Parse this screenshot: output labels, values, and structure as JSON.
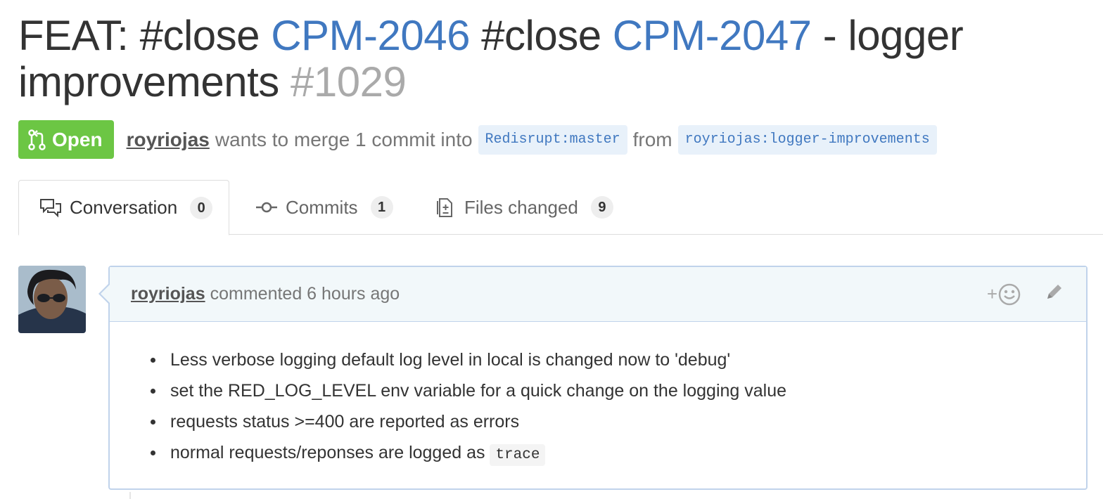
{
  "pr": {
    "title_prefix": "FEAT: #close",
    "issue1": "CPM-2046",
    "title_mid": "#close",
    "issue2": "CPM-2047",
    "title_suffix": "- logger improvements",
    "number": "#1029"
  },
  "state": {
    "label": "Open",
    "color": "#6cc644",
    "icon": "git-pull-request-icon"
  },
  "meta": {
    "author": "royriojas",
    "text_merge": "wants to merge 1 commit into",
    "base_owner": "Redisrupt",
    "base_branch": "master",
    "text_from": "from",
    "head_owner": "royriojas",
    "head_branch": "logger-improvements"
  },
  "tabs": [
    {
      "label": "Conversation",
      "count": "0",
      "icon": "comment-discussion-icon",
      "selected": true
    },
    {
      "label": "Commits",
      "count": "1",
      "icon": "git-commit-icon",
      "selected": false
    },
    {
      "label": "Files changed",
      "count": "9",
      "icon": "diff-icon",
      "selected": false
    }
  ],
  "comment": {
    "author": "royriojas",
    "action": "commented 6 hours ago",
    "reaction_plus": "+",
    "items": [
      "Less verbose logging default log level in local is changed now to 'debug'",
      "set the RED_LOG_LEVEL env variable for a quick change on the logging value",
      "requests status >=400 are reported as errors",
      "normal requests/reponses are logged as"
    ],
    "code_word": "trace"
  },
  "colors": {
    "link": "#4078c0",
    "open_green": "#6cc644",
    "comment_border": "#c0d3eb",
    "comment_header_bg": "#f2f8fa"
  }
}
